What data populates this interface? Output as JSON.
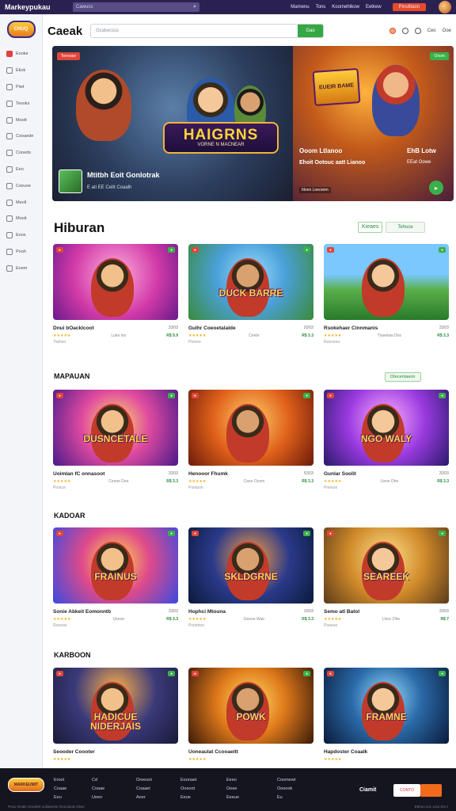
{
  "topbar": {
    "brand": "Markeypukau",
    "search_placeholder": "Cawucs",
    "links": [
      "Mamenu",
      "Tons",
      "Koomehtkow",
      "Eetkew"
    ],
    "cta": "Pinulitaon"
  },
  "sidebar": {
    "logo": "CHUQ",
    "items": [
      {
        "label": "Eooke"
      },
      {
        "label": "Ekok"
      },
      {
        "label": "Piwt"
      },
      {
        "label": "Teooks"
      },
      {
        "label": "Moott"
      },
      {
        "label": "Cooaede"
      },
      {
        "label": "Cooeds"
      },
      {
        "label": "Eeo"
      },
      {
        "label": "Ceeuse"
      },
      {
        "label": "Meoll"
      },
      {
        "label": "Mooit"
      },
      {
        "label": "Eoos"
      },
      {
        "label": "Pooh"
      },
      {
        "label": "Eoem"
      }
    ]
  },
  "header": {
    "title": "Caeak",
    "search_placeholder": "Gcatwcsss",
    "search_button": "Gao",
    "links": [
      "Ceo",
      "Ooe"
    ]
  },
  "hero": {
    "left_tag": "Tereoaw",
    "logo_line1": "HAIGRNS",
    "logo_line2": "VORNE N MACNEAR",
    "game_name": "Mtitbh Eoit GonIotrak",
    "game_sub": "E ati EE Ceitt Coaalh",
    "right_logo": "EUEIR BAME",
    "right_title": "Ooom Ltlanoo",
    "right_title2": "EhB Lotw",
    "right_sub": "Ehoit Ootouc aatt Lianoo",
    "right_sub2": "EEat Oowe",
    "right_foot": "Itloon Loecwen",
    "right_tag": "Onom"
  },
  "sections": [
    {
      "title": "Hiburan",
      "filter_label": "Kieaes",
      "filter_label2": "Tehuce",
      "cards": [
        {
          "name": "Dnui bOacklcoot",
          "price": "3303",
          "stars": "★★★★★",
          "meta": "Luke loo",
          "cost": "R$ 9.9",
          "sub": "Tialnoo",
          "theme": "pink",
          "word": ""
        },
        {
          "name": "Gulhr Coeoetalalde",
          "price": "9303",
          "stars": "★★★★★",
          "meta": "Ceete",
          "cost": "R$ 3.3",
          "sub": "Ptonee",
          "theme": "green",
          "word": "DUCK BARRE"
        },
        {
          "name": "Rsokehaer Cinnmanis",
          "price": "3303",
          "stars": "★★★★★",
          "meta": "Tlueelaw Doo",
          "cost": "R$ 3.3",
          "sub": "Rueceea",
          "theme": "meadow",
          "word": ""
        }
      ]
    },
    {
      "title": "MAPAUAN",
      "filter_label": "Otecentaeon",
      "cards": [
        {
          "name": "Uoimlan fC onnasoot",
          "price": "3303",
          "stars": "★★★★★",
          "meta": "Ceooe Dee",
          "cost": "R$ 3.3",
          "sub": "Pronce",
          "theme": "purple",
          "word": "DUSNCETALE"
        },
        {
          "name": "Henooor Fhumk",
          "price": "5303",
          "stars": "★★★★★",
          "meta": "Ceeo Ocem",
          "cost": "R$ 3.3",
          "sub": "Pontaon",
          "theme": "orange",
          "word": ""
        },
        {
          "name": "Gunlar Soolit",
          "price": "3303",
          "stars": "★★★★★",
          "meta": "Lleoe Dhe",
          "cost": "R$ 3.3",
          "sub": "Pnenue",
          "theme": "violet",
          "word": "NGO WALY"
        }
      ]
    },
    {
      "title": "KADOAR",
      "cards": [
        {
          "name": "Sonie Abkeit Eomonntb",
          "price": "3303",
          "stars": "★★★★★",
          "meta": "Ueeoe",
          "cost": "R$ 3.3",
          "sub": "Rooeae",
          "theme": "rainbow",
          "word": "FRAINUS"
        },
        {
          "name": "Hophci Mtouna",
          "price": "3303",
          "stars": "★★★★★",
          "meta": "Geeoe Wae",
          "cost": "R$ 3.3",
          "sub": "Poomtoo",
          "theme": "navy",
          "word": "SKLDGRNE"
        },
        {
          "name": "Semo atl Batol",
          "price": "3303",
          "stars": "★★★★★",
          "meta": "Lleoc Dhe",
          "cost": "R$ 7",
          "sub": "Poeeoe",
          "theme": "amber",
          "word": "SEAREEK"
        }
      ]
    },
    {
      "title": "KARBOON",
      "cards": [
        {
          "name": "Seooder Coooter",
          "price": "",
          "stars": "★★★★★",
          "meta": "",
          "cost": "",
          "sub": "",
          "theme": "dusk",
          "word": "HADICUE NIDERJAIS"
        },
        {
          "name": "Uoneaulat Ccooaeitt",
          "price": "",
          "stars": "★★★★★",
          "meta": "",
          "cost": "",
          "sub": "",
          "theme": "fire",
          "word": "POWK"
        },
        {
          "name": "Hapdoster Coaalk",
          "price": "",
          "stars": "★★★★★",
          "meta": "",
          "cost": "",
          "sub": "",
          "theme": "storm",
          "word": "FRAMNE"
        }
      ]
    }
  ],
  "footer": {
    "logo": "MARKEUMIT",
    "cols": [
      [
        "Eroot",
        "Coaae",
        "Eeu"
      ],
      [
        "Cd",
        "Coaae",
        "Ueeo"
      ],
      [
        "Oreeoot",
        "Coaaet",
        "Aoer"
      ],
      [
        "Eoonaet",
        "Ooeont",
        "Eeoe"
      ],
      [
        "Eeeo",
        "Oeee",
        "Eeeue"
      ],
      [
        "Coomewt",
        "Ooeook",
        "Eu"
      ]
    ],
    "note": "Pooo Gniee Ctooiket ooliaseree Goooloow Ckee",
    "note2": "Etteoo eoc Ltoe iGo t",
    "brand": "Ciamit",
    "box": "CONTO"
  },
  "colors": {
    "accent": "#34a842",
    "topbar": "#2b2150",
    "cta": "#e8492a",
    "star": "#f2b01e"
  }
}
